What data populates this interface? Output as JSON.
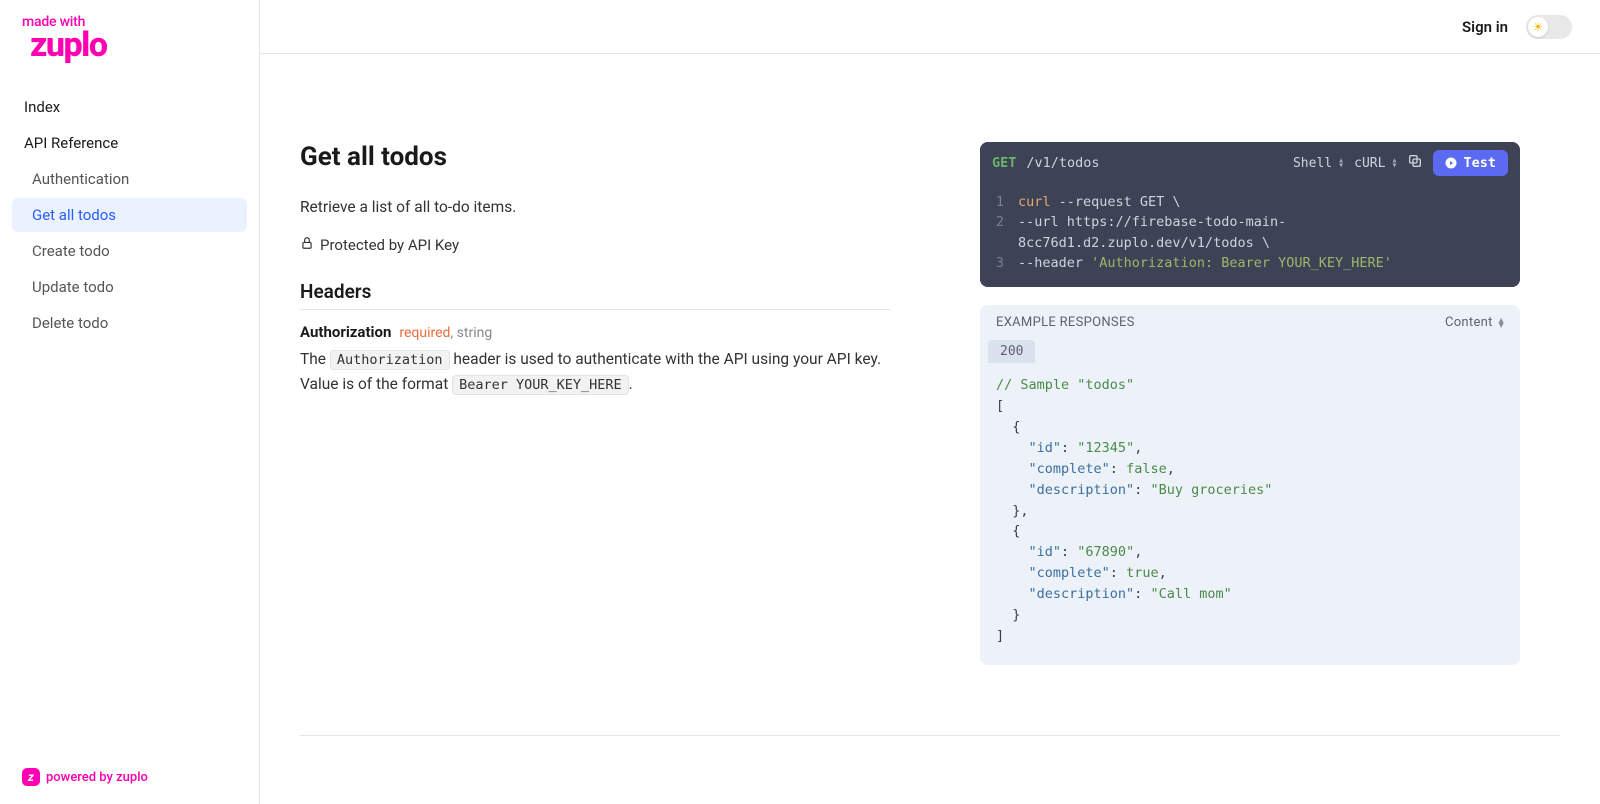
{
  "brand": {
    "made_with": "made with",
    "name": "zuplo",
    "footer_text": "powered by zuplo",
    "footer_badge": "z"
  },
  "topbar": {
    "signin": "Sign in"
  },
  "nav": {
    "index": "Index",
    "api_ref": "API Reference",
    "auth": "Authentication",
    "get_all": "Get all todos",
    "create": "Create todo",
    "update": "Update todo",
    "delete": "Delete todo"
  },
  "page": {
    "title": "Get all todos",
    "description": "Retrieve a list of all to-do items.",
    "protected": "Protected by API Key",
    "headers_heading": "Headers",
    "param_name": "Authorization",
    "param_required": "required",
    "param_type": ", string",
    "param_desc_1": "The ",
    "param_code_1": "Authorization",
    "param_desc_2": " header is used to authenticate with the API using your API key. Value is of the format ",
    "param_code_2": "Bearer YOUR_KEY_HERE",
    "param_desc_3": "."
  },
  "request": {
    "method": "GET",
    "path": "/v1/todos",
    "lang_label": "Shell",
    "client_label": "cURL",
    "test_label": "Test",
    "code": {
      "l1_cmd": "curl",
      "l1_rest": " --request GET \\",
      "l2": "  --url https://firebase-todo-main-8cc76d1.d2.zuplo.dev/v1/todos \\",
      "l3_a": "  --header ",
      "l3_b": "'Authorization: Bearer YOUR_KEY_HERE'"
    }
  },
  "response": {
    "title": "EXAMPLE RESPONSES",
    "content_label": "Content",
    "tab": "200",
    "body": {
      "comment": "// Sample \"todos\"",
      "open_arr": "[",
      "open_obj": "  {",
      "id_k": "    \"id\"",
      "id_v1": "\"12345\"",
      "complete_k": "    \"complete\"",
      "complete_v1": "false",
      "desc_k": "    \"description\"",
      "desc_v1": "\"Buy groceries\"",
      "close_obj_c": "  },",
      "id_v2": "\"67890\"",
      "complete_v2": "true",
      "desc_v2": "\"Call mom\"",
      "close_obj": "  }",
      "close_arr": "]"
    }
  }
}
